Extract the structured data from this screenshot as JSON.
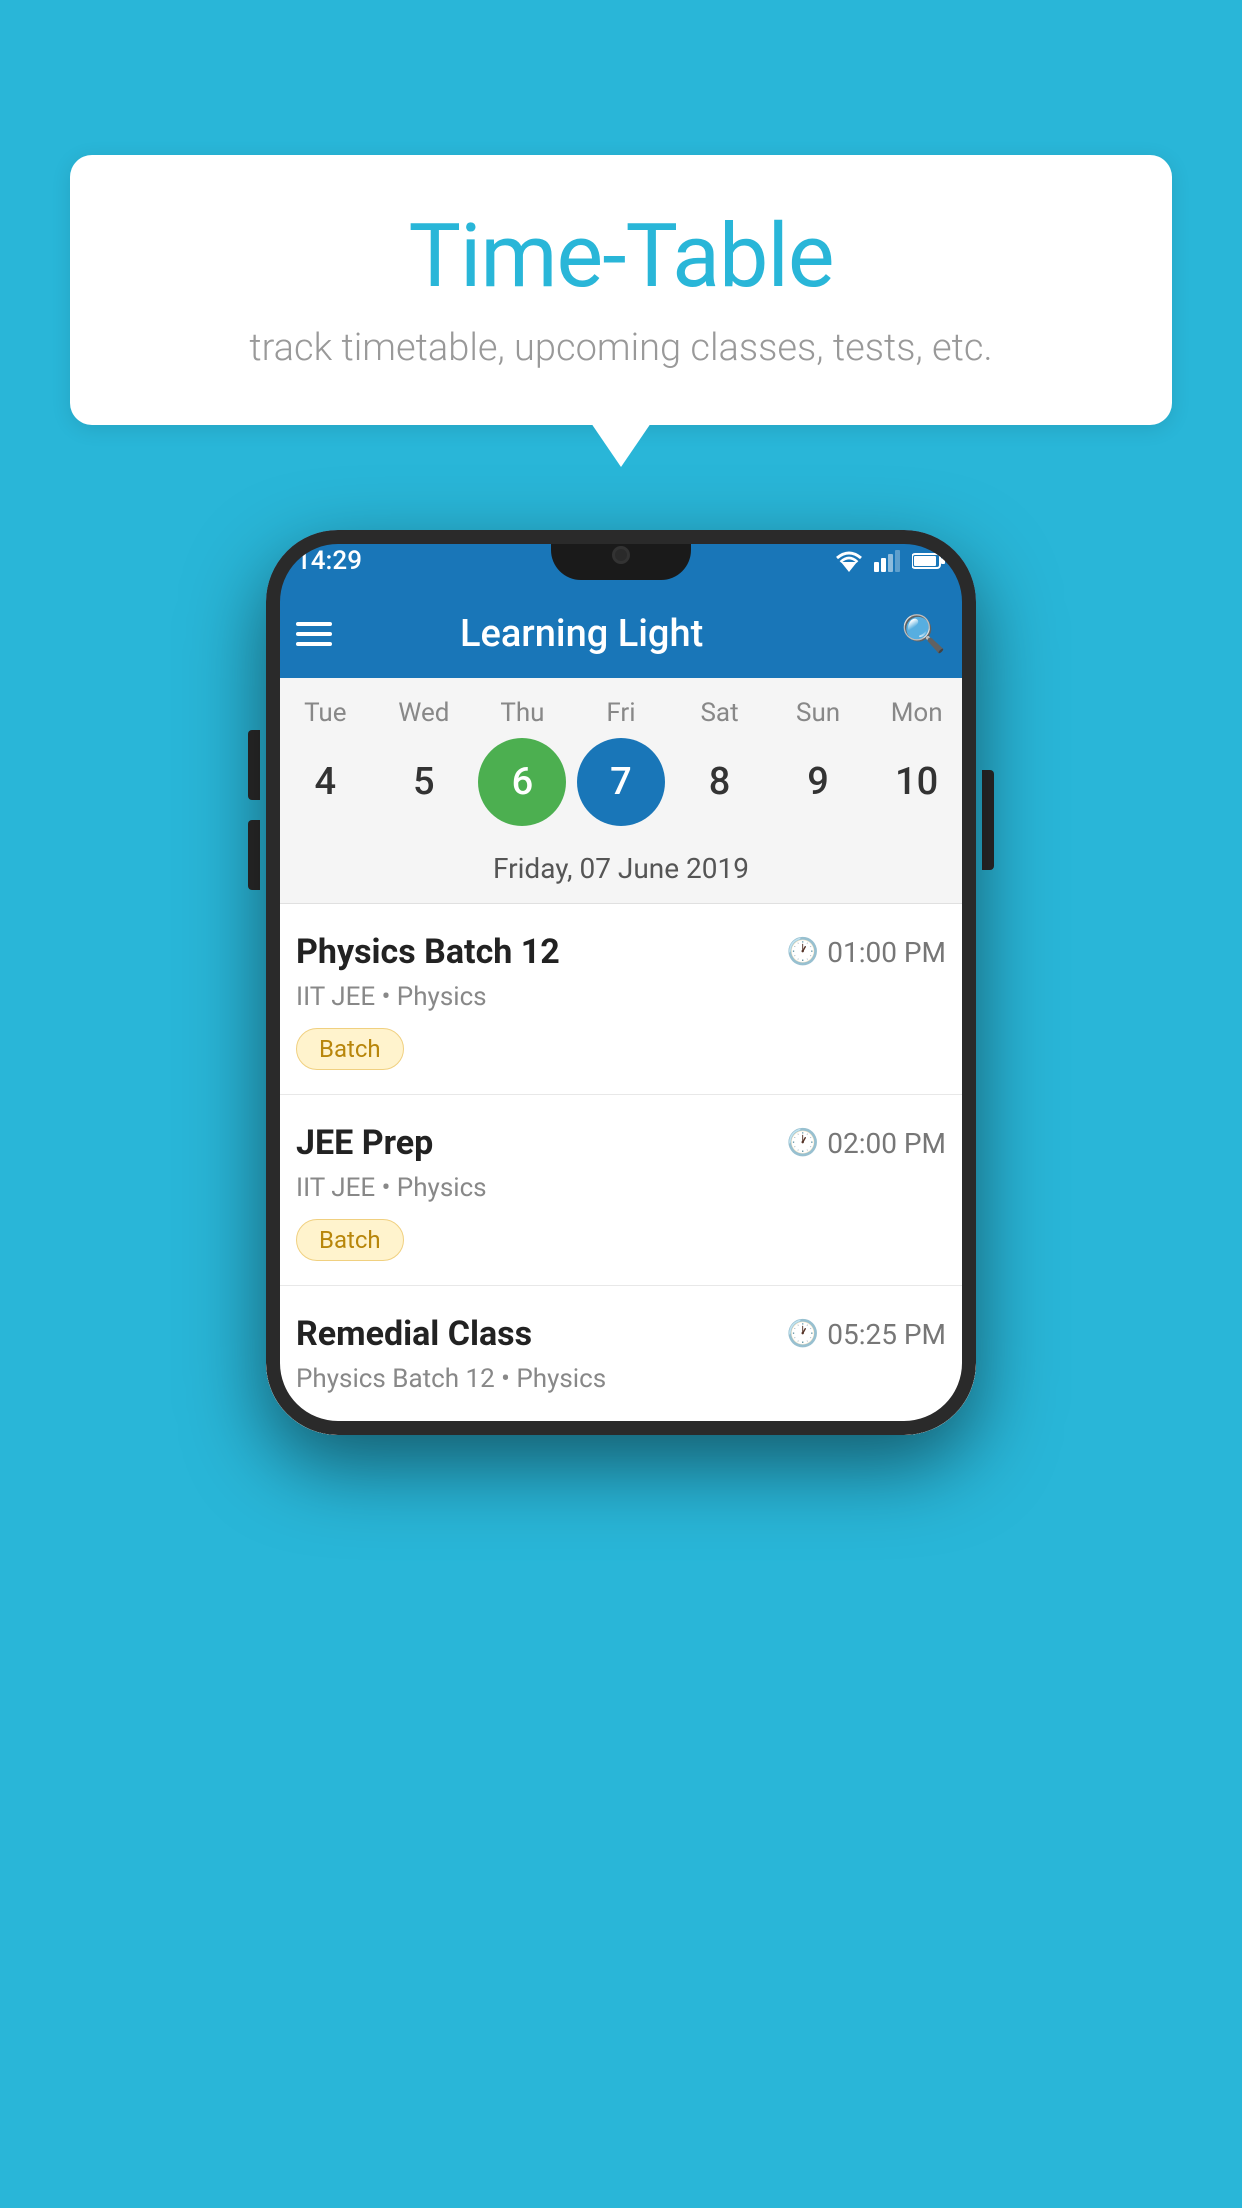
{
  "background_color": "#29b6d8",
  "bubble": {
    "title": "Time-Table",
    "subtitle": "track timetable, upcoming classes, tests, etc."
  },
  "phone": {
    "status_bar": {
      "time": "14:29"
    },
    "app_bar": {
      "title": "Learning Light"
    },
    "calendar": {
      "days": [
        {
          "label": "Tue",
          "number": "4"
        },
        {
          "label": "Wed",
          "number": "5"
        },
        {
          "label": "Thu",
          "number": "6",
          "state": "today"
        },
        {
          "label": "Fri",
          "number": "7",
          "state": "selected"
        },
        {
          "label": "Sat",
          "number": "8"
        },
        {
          "label": "Sun",
          "number": "9"
        },
        {
          "label": "Mon",
          "number": "10"
        }
      ],
      "selected_date": "Friday, 07 June 2019"
    },
    "schedule": [
      {
        "title": "Physics Batch 12",
        "time": "01:00 PM",
        "subtitle": "IIT JEE • Physics",
        "tag": "Batch"
      },
      {
        "title": "JEE Prep",
        "time": "02:00 PM",
        "subtitle": "IIT JEE • Physics",
        "tag": "Batch"
      },
      {
        "title": "Remedial Class",
        "time": "05:25 PM",
        "subtitle": "Physics Batch 12 • Physics",
        "tag": ""
      }
    ]
  }
}
